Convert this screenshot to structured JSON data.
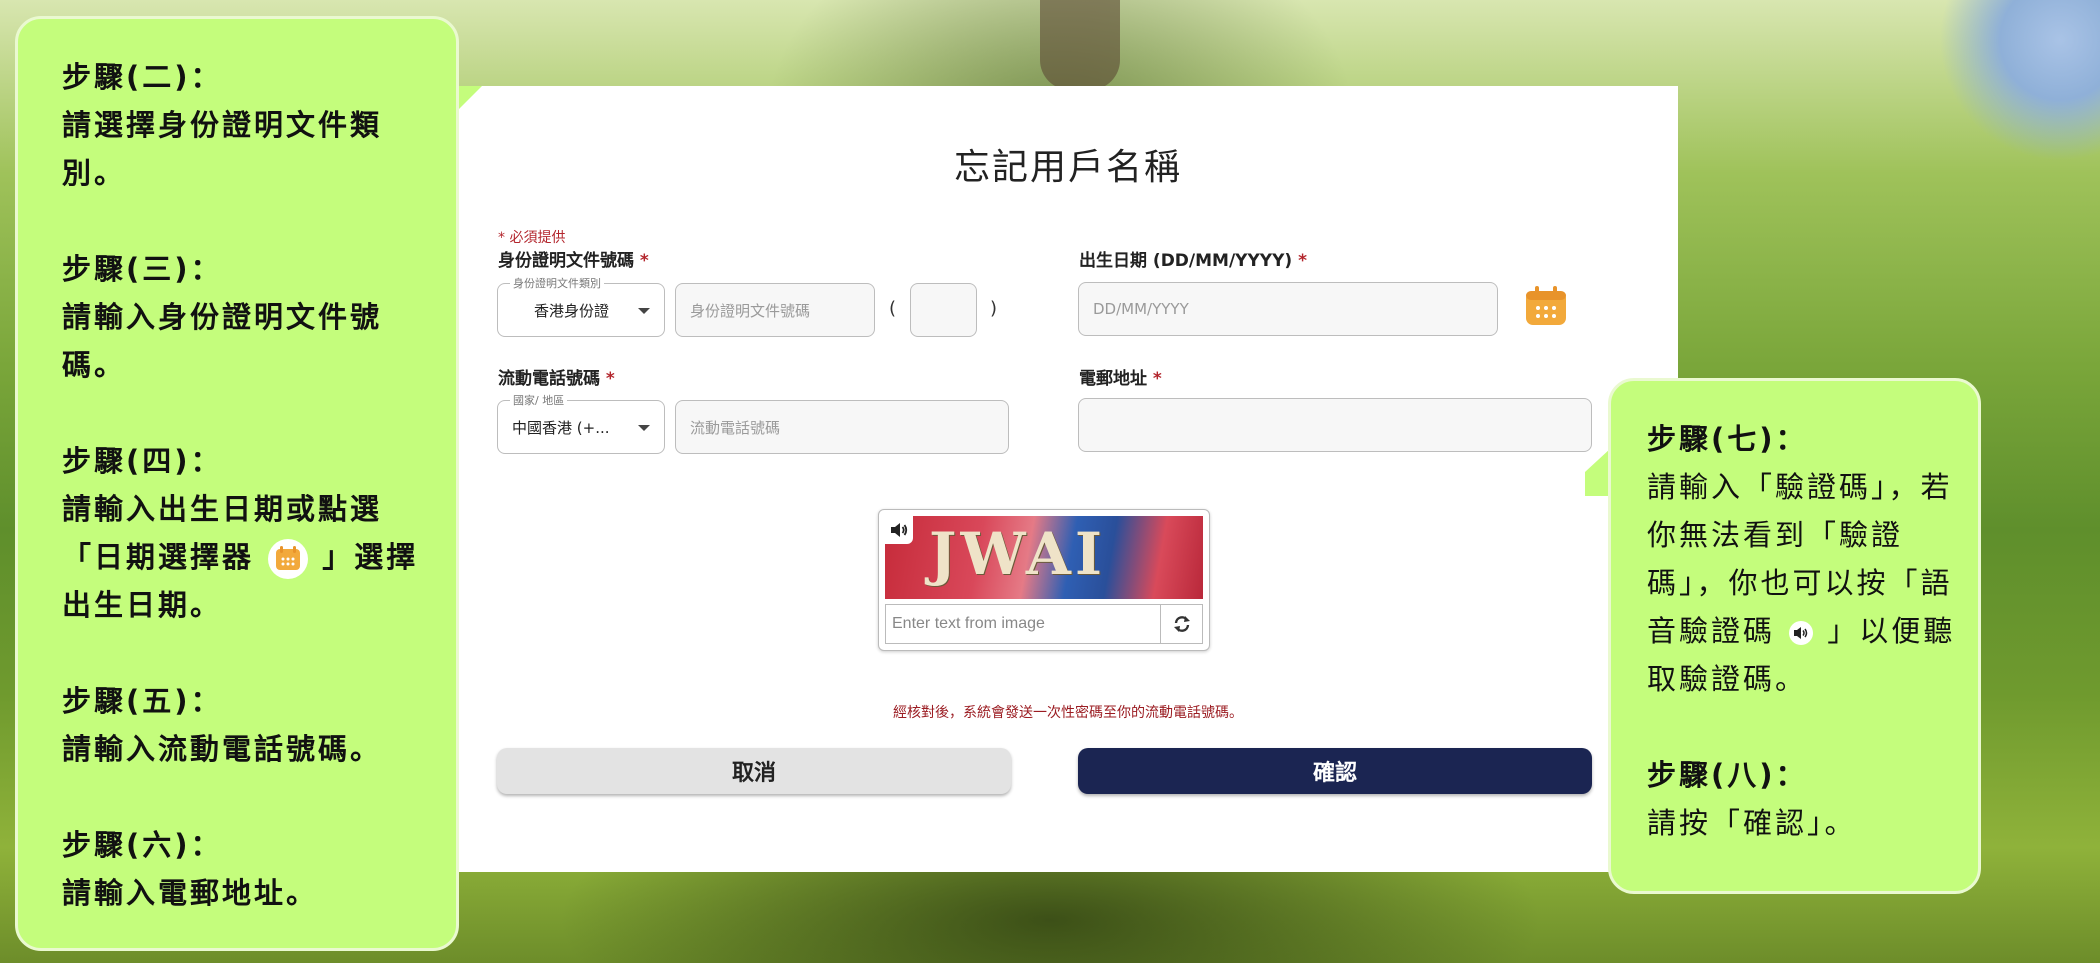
{
  "form": {
    "title": "忘記用戶名稱",
    "required_note": "* 必須提供",
    "id_doc": {
      "label": "身份證明文件號碼",
      "required_mark": "*",
      "type_legend": "身份證明文件類別",
      "type_value": "香港身份證",
      "number_placeholder": "身份證明文件號碼",
      "check_digit_open": "(",
      "check_digit_close": ")"
    },
    "dob": {
      "label": "出生日期 (DD/MM/YYYY)",
      "required_mark": "*",
      "placeholder": "DD/MM/YYYY"
    },
    "mobile": {
      "label": "流動電話號碼",
      "required_mark": "*",
      "country_legend": "國家/ 地區",
      "country_value": "中國香港 (+...",
      "number_placeholder": "流動電話號碼"
    },
    "email": {
      "label": "電郵地址",
      "required_mark": "*",
      "value": ""
    },
    "captcha": {
      "image_text": "JWAI",
      "input_placeholder": "Enter text from image"
    },
    "otp_note": "經核對後，系統會發送一次性密碼至你的流動電話號碼。",
    "cancel_label": "取消",
    "confirm_label": "確認"
  },
  "instructions_left": [
    {
      "heading": "步驟(二)：",
      "body": "請選擇身份證明文件類別。"
    },
    {
      "heading": "步驟(三)：",
      "body": "請輸入身份證明文件號碼。"
    },
    {
      "heading": "步驟(四)：",
      "body_before": "請輸入出生日期或點選「日期選擇器",
      "body_after": "」選擇出生日期。"
    },
    {
      "heading": "步驟(五)：",
      "body": "請輸入流動電話號碼。"
    },
    {
      "heading": "步驟(六)：",
      "body": "請輸入電郵地址。"
    }
  ],
  "instructions_right": [
    {
      "heading": "步驟(七)：",
      "body_before": "請輸入「驗證碼」，若你無法看到「驗證碼」，你也可以按「語音驗證碼",
      "body_after": "」以便聽取驗證碼。"
    },
    {
      "heading": "步驟(八)：",
      "body": "請按「確認」。"
    }
  ],
  "colors": {
    "bubble": "#c4fd7c",
    "confirm_button": "#1b2552",
    "required": "#b3262d",
    "calendar_icon": "#f2a93b"
  },
  "icons": [
    "calendar-icon",
    "speaker-icon",
    "refresh-icon",
    "dropdown-caret-icon"
  ]
}
